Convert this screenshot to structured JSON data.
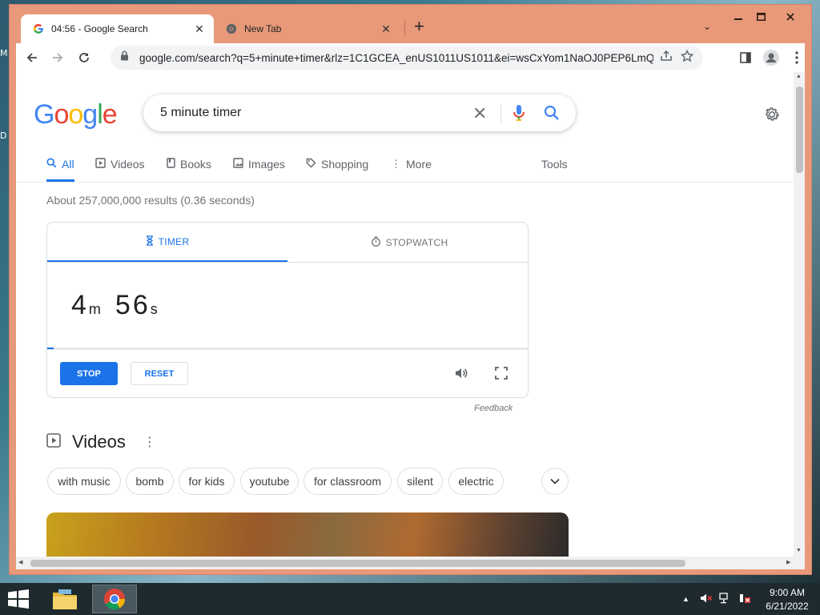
{
  "desktop": {
    "edge_letters": [
      "M",
      "D"
    ]
  },
  "window": {
    "tabs": [
      {
        "title": "04:56 - Google Search",
        "icon": "google-g-icon",
        "active": true
      },
      {
        "title": "New Tab",
        "icon": "chrome-icon",
        "active": false
      }
    ],
    "new_tab_label": "+"
  },
  "toolbar": {
    "url": "google.com/search?q=5+minute+timer&rlz=1C1GCEA_enUS1011US1011&ei=wsCxYom1NaOJ0PEP6LmQi..."
  },
  "search": {
    "logo_letters": [
      "G",
      "o",
      "o",
      "g",
      "l",
      "e"
    ],
    "logo_colors": [
      "#4285f4",
      "#ea4335",
      "#fbbc05",
      "#4285f4",
      "#34a853",
      "#ea4335"
    ],
    "query": "5 minute timer"
  },
  "nav": {
    "items": [
      {
        "label": "All",
        "active": true
      },
      {
        "label": "Videos"
      },
      {
        "label": "Books"
      },
      {
        "label": "Images"
      },
      {
        "label": "Shopping"
      },
      {
        "label": "More"
      }
    ],
    "tools": "Tools"
  },
  "stats": "About 257,000,000 results (0.36 seconds)",
  "timer": {
    "tabs": {
      "timer": "TIMER",
      "stopwatch": "STOPWATCH"
    },
    "minutes": "4",
    "minutes_unit": "m",
    "seconds": "56",
    "seconds_unit": "s",
    "progress": 0.013,
    "stop": "STOP",
    "reset": "RESET"
  },
  "feedback": "Feedback",
  "videos": {
    "title": "Videos",
    "chips": [
      "with music",
      "bomb",
      "for kids",
      "youtube",
      "for classroom",
      "silent",
      "electric"
    ]
  },
  "taskbar": {
    "clock_time": "9:00 AM",
    "clock_date": "6/21/2022"
  },
  "colors": {
    "accent": "#1a73e8",
    "window_frame": "#e8997a"
  }
}
